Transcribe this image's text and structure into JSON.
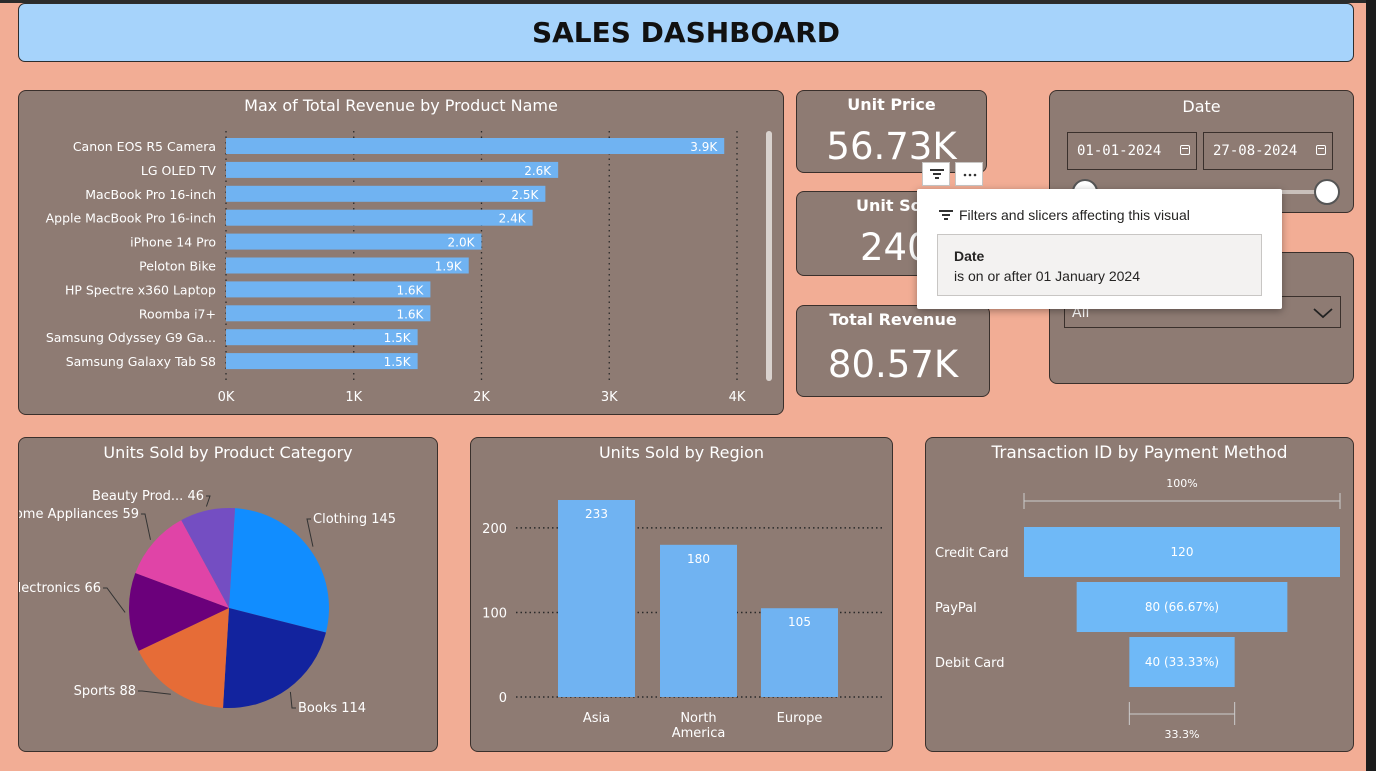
{
  "header": {
    "title": "SALES DASHBOARD"
  },
  "kpis": {
    "unit_price": {
      "label": "Unit Price",
      "value": "56.73K"
    },
    "units_sold": {
      "label": "Unit Sol",
      "value": "240"
    },
    "total_revenue": {
      "label": "Total Revenue",
      "value": "80.57K"
    }
  },
  "date_slicer": {
    "title": "Date",
    "start": "01-01-2024",
    "end": "27-08-2024",
    "start_fraction": 0.0,
    "end_fraction": 1.0
  },
  "dropdown_slicer": {
    "selected": "All"
  },
  "tooltip": {
    "header": "Filters and slicers affecting this visual",
    "field": "Date",
    "condition": "is on or after 01 January 2024"
  },
  "visual_header_icons": [
    "filter-icon",
    "more-options-icon"
  ],
  "colors": {
    "background": "#f2ad95",
    "panel": "#8e7b73",
    "header": "#a6d3fb",
    "bar": "#70b3f2",
    "funnel": "#6fb9f7"
  },
  "chart_data": [
    {
      "type": "bar",
      "orientation": "horizontal",
      "title": "Max of Total Revenue by Product Name",
      "categories": [
        "Canon EOS R5 Camera",
        "LG OLED TV",
        "MacBook Pro 16-inch",
        "Apple MacBook Pro 16-inch",
        "iPhone 14 Pro",
        "Peloton Bike",
        "HP Spectre x360 Laptop",
        "Roomba i7+",
        "Samsung Odyssey G9 Ga...",
        "Samsung Galaxy Tab S8"
      ],
      "values": [
        3900,
        2600,
        2500,
        2400,
        2000,
        1900,
        1600,
        1600,
        1500,
        1500
      ],
      "data_labels": [
        "3.9K",
        "2.6K",
        "2.5K",
        "2.4K",
        "2.0K",
        "1.9K",
        "1.6K",
        "1.6K",
        "1.5K",
        "1.5K"
      ],
      "x_ticks": [
        "0K",
        "1K",
        "2K",
        "3K",
        "4K"
      ],
      "xlim": [
        0,
        4000
      ],
      "grid": true
    },
    {
      "type": "pie",
      "title": "Units Sold by Product Category",
      "slices": [
        {
          "label": "Clothing",
          "value": 145,
          "color": "#118dff"
        },
        {
          "label": "Books",
          "value": 114,
          "color": "#12239e"
        },
        {
          "label": "Sports",
          "value": 88,
          "color": "#e66c37"
        },
        {
          "label": "Electronics",
          "value": 66,
          "color": "#6b007b"
        },
        {
          "label": "Home Appliances",
          "value": 59,
          "color": "#e044a7"
        },
        {
          "label": "Beauty Prod...",
          "value": 46,
          "color": "#744ec2"
        }
      ]
    },
    {
      "type": "bar",
      "title": "Units Sold by Region",
      "categories": [
        "Asia",
        "North America",
        "Europe"
      ],
      "values": [
        233,
        180,
        105
      ],
      "y_ticks": [
        0,
        100,
        200
      ],
      "ylim": [
        0,
        233
      ],
      "grid": true
    },
    {
      "type": "funnel",
      "title": "Transaction ID by Payment Method",
      "categories": [
        "Credit Card",
        "PayPal",
        "Debit Card"
      ],
      "values": [
        120,
        80,
        40
      ],
      "data_labels": [
        "120",
        "80 (66.67%)",
        "40 (33.33%)"
      ],
      "top_label": "100%",
      "bottom_label": "33.3%"
    }
  ]
}
